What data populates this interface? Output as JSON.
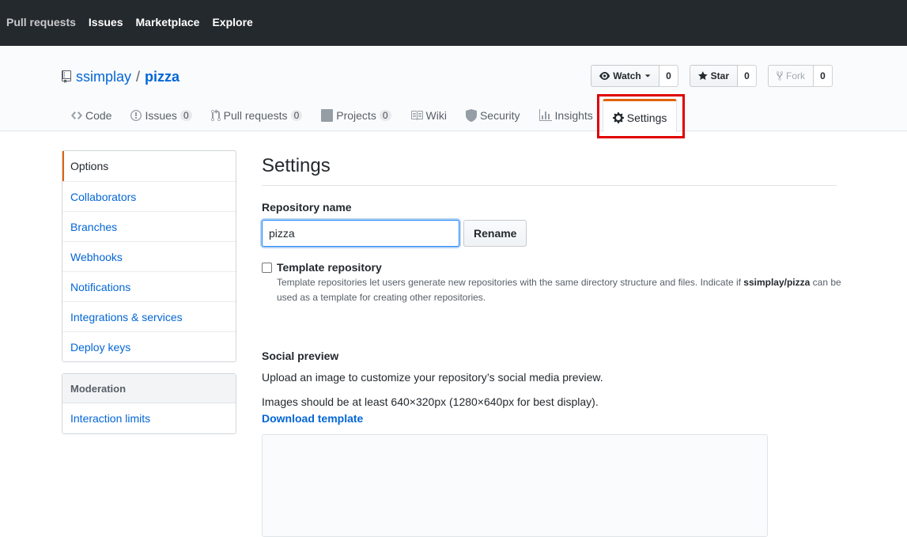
{
  "top_nav": [
    "Pull requests",
    "Issues",
    "Marketplace",
    "Explore"
  ],
  "repo": {
    "owner": "ssimplay",
    "separator": "/",
    "name": "pizza"
  },
  "actions": {
    "watch": {
      "label": "Watch",
      "count": "0"
    },
    "star": {
      "label": "Star",
      "count": "0"
    },
    "fork": {
      "label": "Fork",
      "count": "0"
    }
  },
  "tabs": [
    {
      "label": "Code",
      "icon": "code-icon"
    },
    {
      "label": "Issues",
      "icon": "issue-icon",
      "count": "0"
    },
    {
      "label": "Pull requests",
      "icon": "pull-request-icon",
      "count": "0"
    },
    {
      "label": "Projects",
      "icon": "project-icon",
      "count": "0"
    },
    {
      "label": "Wiki",
      "icon": "book-icon"
    },
    {
      "label": "Security",
      "icon": "shield-icon"
    },
    {
      "label": "Insights",
      "icon": "graph-icon"
    },
    {
      "label": "Settings",
      "icon": "gear-icon",
      "selected": true
    }
  ],
  "sidebar": {
    "items": [
      "Options",
      "Collaborators",
      "Branches",
      "Webhooks",
      "Notifications",
      "Integrations & services",
      "Deploy keys"
    ],
    "moderation": {
      "heading": "Moderation",
      "items": [
        "Interaction limits"
      ]
    }
  },
  "settings": {
    "title": "Settings",
    "repo_name_label": "Repository name",
    "repo_name_value": "pizza",
    "rename_button": "Rename",
    "template_label": "Template repository",
    "template_note_1": "Template repositories let users generate new repositories with the same directory structure and files. Indicate if ",
    "template_note_bold": "ssimplay/pizza",
    "template_note_2": " can be",
    "template_note_3": "used as a template for creating other repositories.",
    "social_title": "Social preview",
    "social_desc": "Upload an image to customize your repository’s social media preview.",
    "social_size": "Images should be at least 640×320px (1280×640px for best display).",
    "download_template": "Download template"
  },
  "colors": {
    "header_bg": "#24292e",
    "link": "#0366d6",
    "accent": "#e36209",
    "highlight": "#e00000"
  }
}
